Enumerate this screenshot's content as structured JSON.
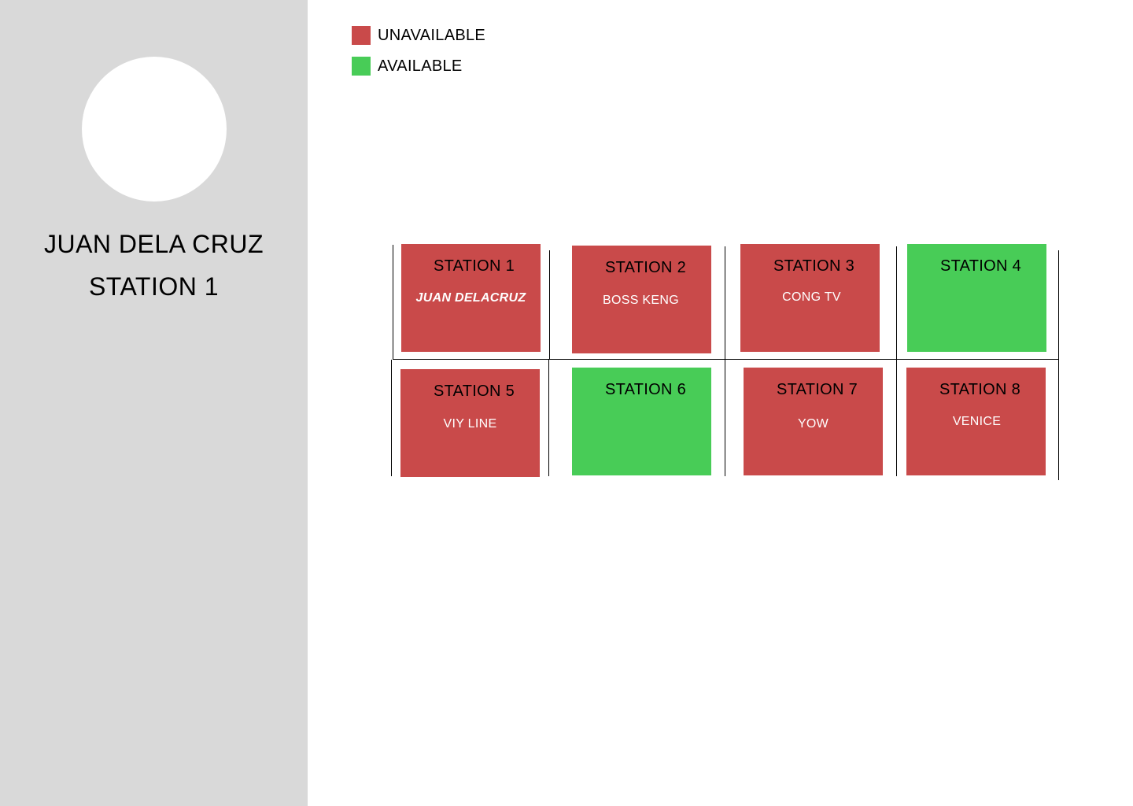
{
  "sidebar": {
    "user_name": "JUAN DELA CRUZ",
    "user_station": "STATION 1"
  },
  "legend": [
    {
      "label": "UNAVAILABLE",
      "color": "#c94a4a"
    },
    {
      "label": "AVAILABLE",
      "color": "#48cc57"
    }
  ],
  "colors": {
    "unavailable": "#c94a4a",
    "available": "#48cc57",
    "sidebar_bg": "#d9d9d9"
  },
  "stations": [
    {
      "title": "STATION 1",
      "occupant": "JUAN DELACRUZ",
      "status": "unavailable"
    },
    {
      "title": "STATION 2",
      "occupant": "BOSS KENG",
      "status": "unavailable"
    },
    {
      "title": "STATION 3",
      "occupant": "CONG TV",
      "status": "unavailable"
    },
    {
      "title": "STATION 4",
      "occupant": "",
      "status": "available"
    },
    {
      "title": "STATION 5",
      "occupant": "VIY LINE",
      "status": "unavailable"
    },
    {
      "title": "STATION 6",
      "occupant": "",
      "status": "available"
    },
    {
      "title": "STATION 7",
      "occupant": "YOW",
      "status": "unavailable"
    },
    {
      "title": "STATION 8",
      "occupant": "VENICE",
      "status": "unavailable"
    }
  ]
}
